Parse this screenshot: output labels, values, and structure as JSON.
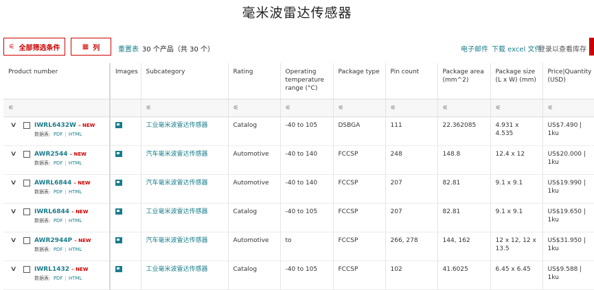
{
  "page": {
    "title": "毫米波雷达传感器"
  },
  "toolbar": {
    "all_filters_label": "全部筛选条件",
    "columns_label": "列",
    "reset_label": "重置表",
    "result_count": "30 个产品（共 30 个）",
    "email_label": "电子邮件",
    "excel_label": "下载 excel 文件",
    "stock_label": "登录以查看库存"
  },
  "table": {
    "headers": [
      "Product number",
      "Images",
      "Subcategory",
      "Rating",
      "Operating temperature range (°C)",
      "Package type",
      "Pin count",
      "Package area (mm^2)",
      "Package size (L x W) (mm)",
      "Price|Quantity (USD)"
    ],
    "datasheet_label": "数据表:",
    "pdf_label": "PDF",
    "html_label": "HTML",
    "new_label": "– NEW",
    "rows": [
      {
        "product": "IWRL6432W",
        "subcategory": "工业毫米波雷达传感器",
        "rating": "Catalog",
        "temp": "-40 to 105",
        "package": "DSBGA",
        "pins": "111",
        "area": "22.362085",
        "size": "4.931 x 4.535",
        "price": "US$7.490 | 1ku"
      },
      {
        "product": "AWR2544",
        "subcategory": "汽车毫米波雷达传感器",
        "rating": "Automotive",
        "temp": "-40 to 140",
        "package": "FCCSP",
        "pins": "248",
        "area": "148.8",
        "size": "12.4 x 12",
        "price": "US$20.000 | 1ku"
      },
      {
        "product": "AWRL6844",
        "subcategory": "汽车毫米波雷达传感器",
        "rating": "Automotive",
        "temp": "-40 to 140",
        "package": "FCCSP",
        "pins": "207",
        "area": "82.81",
        "size": "9.1 x 9.1",
        "price": "US$19.990 | 1ku"
      },
      {
        "product": "IWRL6844",
        "subcategory": "工业毫米波雷达传感器",
        "rating": "Catalog",
        "temp": "-40 to 105",
        "package": "FCCSP",
        "pins": "207",
        "area": "82.81",
        "size": "9.1 x 9.1",
        "price": "US$19.650 | 1ku"
      },
      {
        "product": "AWR2944P",
        "subcategory": "汽车毫米波雷达传感器",
        "rating": "Automotive",
        "temp": "to",
        "package": "FCCSP",
        "pins": "266, 278",
        "area": "144, 162",
        "size": "12 x 12, 12 x 13.5",
        "price": "US$31.950 | 1ku"
      },
      {
        "product": "IWRL1432",
        "subcategory": "工业毫米波雷达传感器",
        "rating": "Catalog",
        "temp": "-40 to 105",
        "package": "FCCSP",
        "pins": "102",
        "area": "41.6025",
        "size": "6.45 x 6.45",
        "price": "US$9.588 | 1ku"
      }
    ]
  },
  "colors": {
    "accent_red": "#cc0000",
    "link_teal": "#1a7d8c"
  },
  "icons": {
    "filter": "sliders-icon",
    "columns": "table-icon",
    "image": "image-icon",
    "expand": "chevron-down-icon"
  }
}
